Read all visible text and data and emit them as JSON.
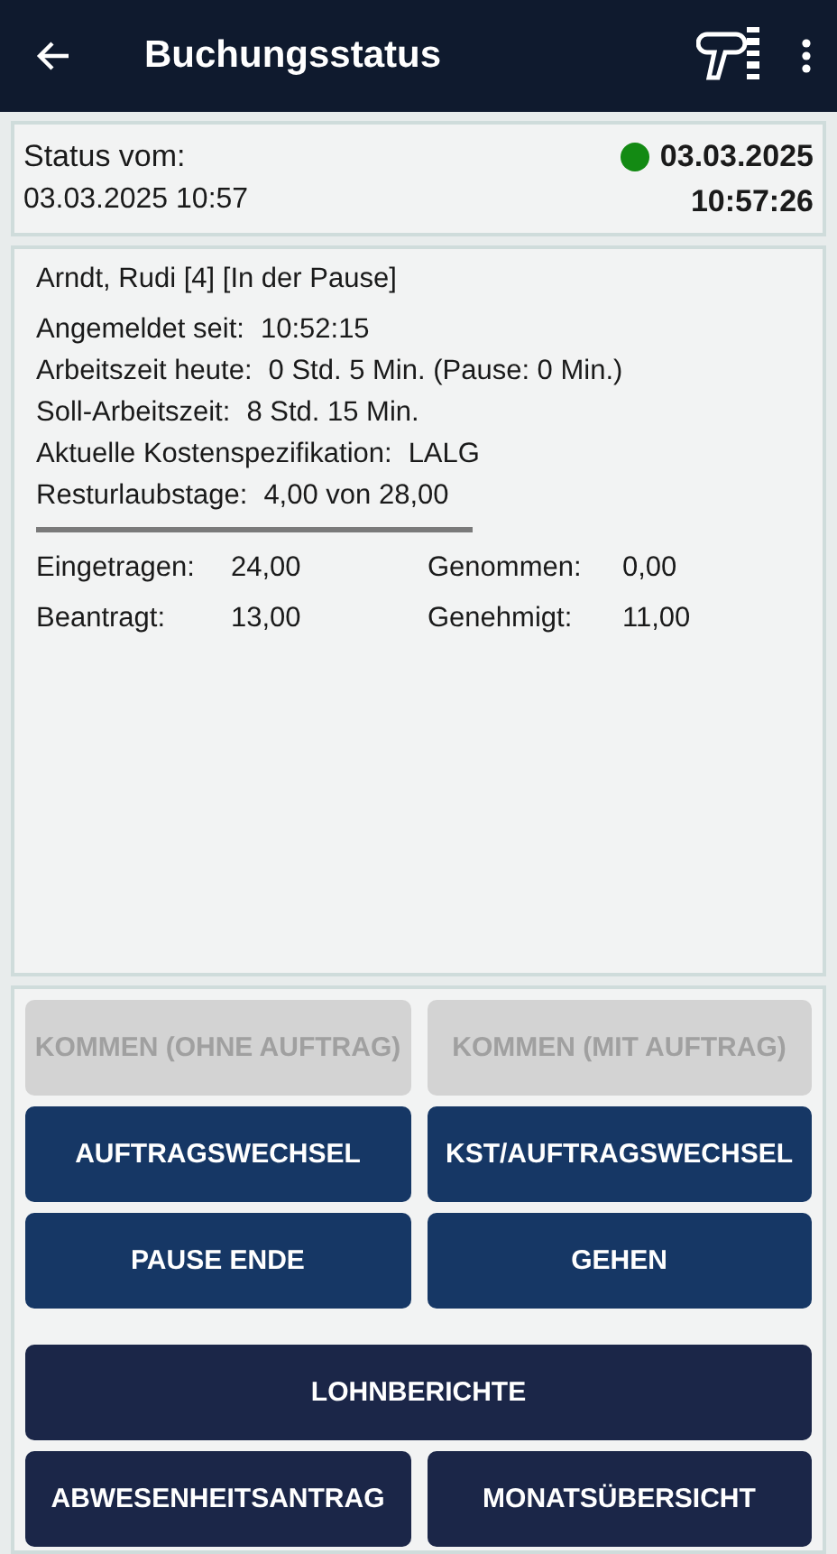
{
  "app_bar": {
    "title": "Buchungsstatus"
  },
  "status": {
    "label": "Status vom:",
    "timestamp": "03.03.2025 10:57",
    "color": "#138a13",
    "date": "03.03.2025",
    "time": "10:57:26"
  },
  "employee": {
    "name": "Arndt, Rudi [4] [In der Pause]",
    "details": [
      {
        "label": "Angemeldet seit:",
        "value": "10:52:15"
      },
      {
        "label": "Arbeitszeit heute:",
        "value": "0 Std. 5 Min. (Pause: 0 Min.)"
      },
      {
        "label": "Soll-Arbeitszeit:",
        "value": "8 Std. 15 Min."
      },
      {
        "label": "Aktuelle Kostenspezifikation:",
        "value": "LALG"
      },
      {
        "label": "Resturlaubstage:",
        "value": "4,00 von 28,00"
      }
    ],
    "vacation": [
      {
        "label": "Eingetragen:",
        "value": "24,00"
      },
      {
        "label": "Genommen:",
        "value": "0,00"
      },
      {
        "label": "Beantragt:",
        "value": "13,00"
      },
      {
        "label": "Genehmigt:",
        "value": "11,00"
      }
    ]
  },
  "booking_buttons": [
    {
      "label": "KOMMEN (OHNE AUFTRAG)",
      "disabled": true
    },
    {
      "label": "KOMMEN (MIT AUFTRAG)",
      "disabled": true
    },
    {
      "label": "AUFTRAGSWECHSEL",
      "disabled": false
    },
    {
      "label": "KST/AUFTRAGSWECHSEL",
      "disabled": false
    },
    {
      "label": "PAUSE ENDE",
      "disabled": false
    },
    {
      "label": "GEHEN",
      "disabled": false
    }
  ],
  "report_buttons": [
    {
      "label": "LOHNBERICHTE",
      "kind": "wide"
    },
    {
      "label": "ABWESENHEITSANTRAG",
      "kind": "half"
    },
    {
      "label": "MONATSÜBERSICHT",
      "kind": "half"
    }
  ]
}
